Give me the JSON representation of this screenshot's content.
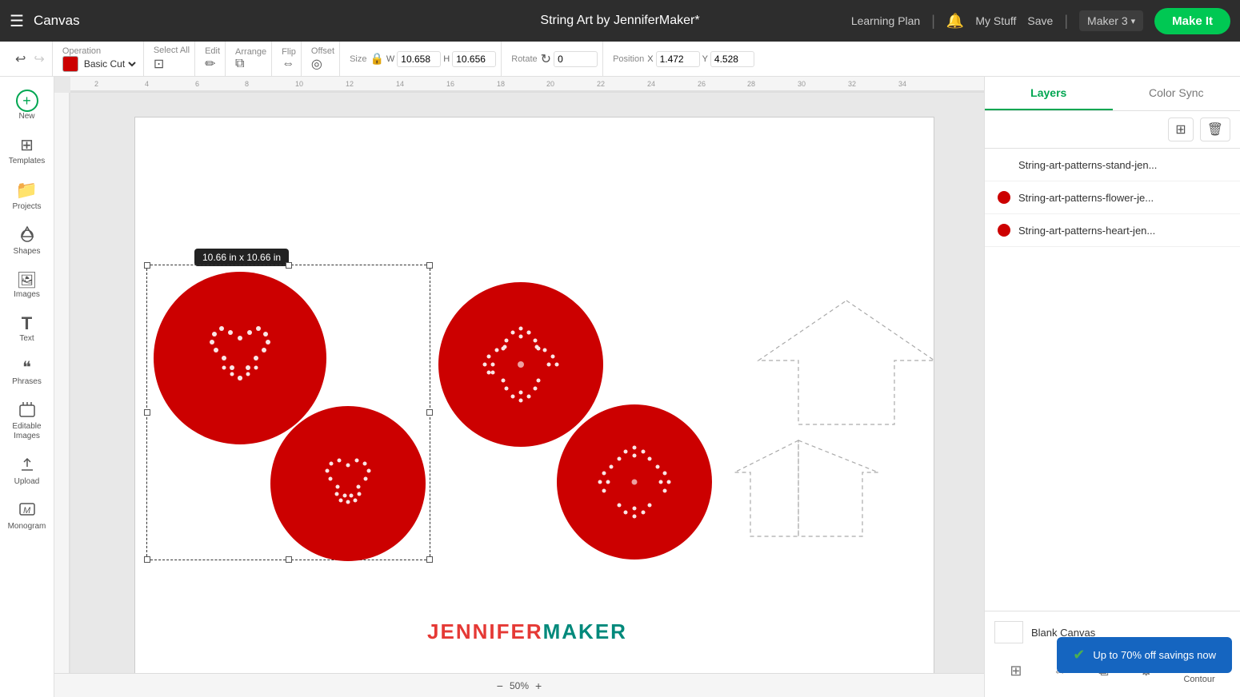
{
  "app": {
    "title": "Canvas",
    "project_title": "String Art by JenniferMaker*"
  },
  "topnav": {
    "hamburger": "☰",
    "learning_plan": "Learning Plan",
    "divider1": "|",
    "bell": "🔔",
    "my_stuff": "My Stuff",
    "save": "Save",
    "divider2": "|",
    "maker": "Maker 3",
    "make_it": "Make It"
  },
  "toolbar": {
    "operation_label": "Operation",
    "operation_value": "Basic Cut",
    "select_all": "Select All",
    "edit": "Edit",
    "arrange": "Arrange",
    "flip": "Flip",
    "offset": "Offset",
    "size_label": "Size",
    "width_label": "W",
    "width_value": "10.658",
    "height_label": "H",
    "height_value": "10.656",
    "rotate_label": "Rotate",
    "rotate_value": "0",
    "position_label": "Position",
    "x_label": "X",
    "x_value": "1.472",
    "y_label": "Y",
    "y_value": "4.528"
  },
  "sidebar": {
    "items": [
      {
        "id": "new",
        "icon": "+",
        "label": "New"
      },
      {
        "id": "templates",
        "icon": "⊞",
        "label": "Templates"
      },
      {
        "id": "projects",
        "icon": "📁",
        "label": "Projects"
      },
      {
        "id": "shapes",
        "icon": "△",
        "label": "Shapes"
      },
      {
        "id": "images",
        "icon": "🖼",
        "label": "Images"
      },
      {
        "id": "text",
        "icon": "T",
        "label": "Text"
      },
      {
        "id": "phrases",
        "icon": "❝",
        "label": "Phrases"
      },
      {
        "id": "editable",
        "icon": "✎",
        "label": "Editable Images"
      },
      {
        "id": "upload",
        "icon": "↑",
        "label": "Upload"
      },
      {
        "id": "monogram",
        "icon": "M",
        "label": "Monogram"
      }
    ]
  },
  "canvas": {
    "size_tooltip": "10.66  in x 10.66  in",
    "zoom_level": "50%"
  },
  "ruler": {
    "ticks": [
      2,
      4,
      6,
      8,
      10,
      12,
      14,
      16,
      18,
      20,
      22,
      24,
      26,
      28,
      30,
      32,
      34
    ]
  },
  "layers": {
    "tab_layers": "Layers",
    "tab_color_sync": "Color Sync",
    "layer_list": [
      {
        "name": "String-art-patterns-stand-jen...",
        "color": "#cc0000",
        "has_dot": false
      },
      {
        "name": "String-art-patterns-flower-je...",
        "color": "#cc0000",
        "has_dot": true
      },
      {
        "name": "String-art-patterns-heart-jen...",
        "color": "#cc0000",
        "has_dot": true
      }
    ],
    "blank_canvas_label": "Blank Canvas",
    "contour_label": "Contour"
  },
  "toast": {
    "icon": "✔",
    "message": "Up to 70% off savings now"
  },
  "watermark": {
    "part1": "JENNIFER",
    "part2": "MAKER"
  }
}
